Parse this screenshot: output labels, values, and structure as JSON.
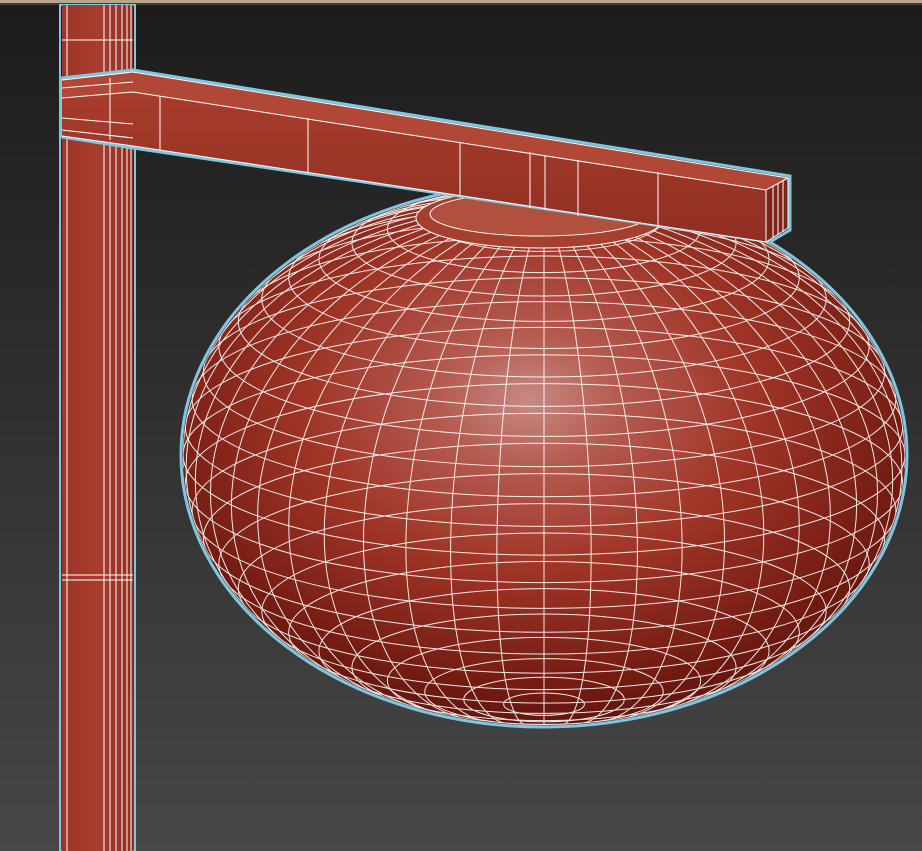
{
  "viewport": {
    "label": "",
    "object": "floor-lamp-wireframe",
    "colors": {
      "background_top": "#1c1c1c",
      "background_bottom": "#474747",
      "viewport_top_border": "#b8a78a",
      "model_fill": "#a33b2c",
      "model_highlight": "#c9837c",
      "model_shadow": "#4a1008",
      "wire_color": "#ffffff",
      "selection_outline": "#7fc6e0"
    }
  }
}
